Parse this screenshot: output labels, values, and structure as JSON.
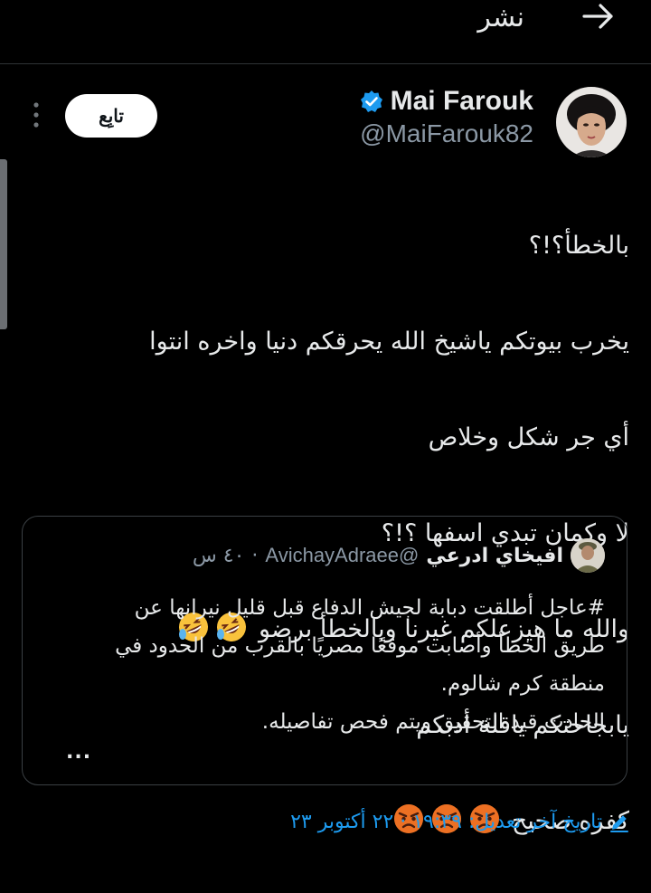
{
  "header": {
    "title": "نشر",
    "back_icon": "arrow-right-icon"
  },
  "author": {
    "display_name": "Mai Farouk",
    "handle": "@MaiFarouk82",
    "verified": true,
    "verified_color": "#1d9bf0"
  },
  "follow_button": {
    "label": "تابِع"
  },
  "more_icon": "vertical-ellipsis-icon",
  "tweet": {
    "lines": [
      "بالخطأ؟!؟",
      "يخرب بيوتكم ياشيخ الله يحرقكم دنيا واخره  انتوا",
      "أي جر شكل وخلاص",
      "لا وكمان تبدي اسفها ؟!؟",
      "والله ما هيزعلكم غيرنا وبالخطأ برضو",
      "يابجاحتكم ياقلة أدبكم",
      "كفره صحيح"
    ],
    "emojis": {
      "line5": [
        "rolling-on-floor-laughing-emoji",
        "rolling-on-floor-laughing-emoji"
      ],
      "line7": [
        "angry-face-emoji",
        "angry-face-emoji",
        "angry-face-emoji"
      ]
    }
  },
  "quote": {
    "name": "افيخاي ادرعي",
    "handle": "@AvichayAdraee",
    "separator": "·",
    "time": "٤٠ س",
    "lines": [
      "#عاجل أطلقت دبابة لجيش الدفاع قبل قليل نيرانها عن",
      "طريق الخطأ وأصابت موقعًا مصريًا بالقرب من الحدود في",
      "منطقة كرم شالوم.",
      "الحادث قيد التحقيق ويتم فحص تفاصيله."
    ],
    "more": "..."
  },
  "edited": {
    "text": "تاريخ آخر تعديل: ١٩:٣٩ · ٢٢ أكتوبر ٢٣",
    "icon": "pencil-icon",
    "color": "#1d9bf0"
  }
}
